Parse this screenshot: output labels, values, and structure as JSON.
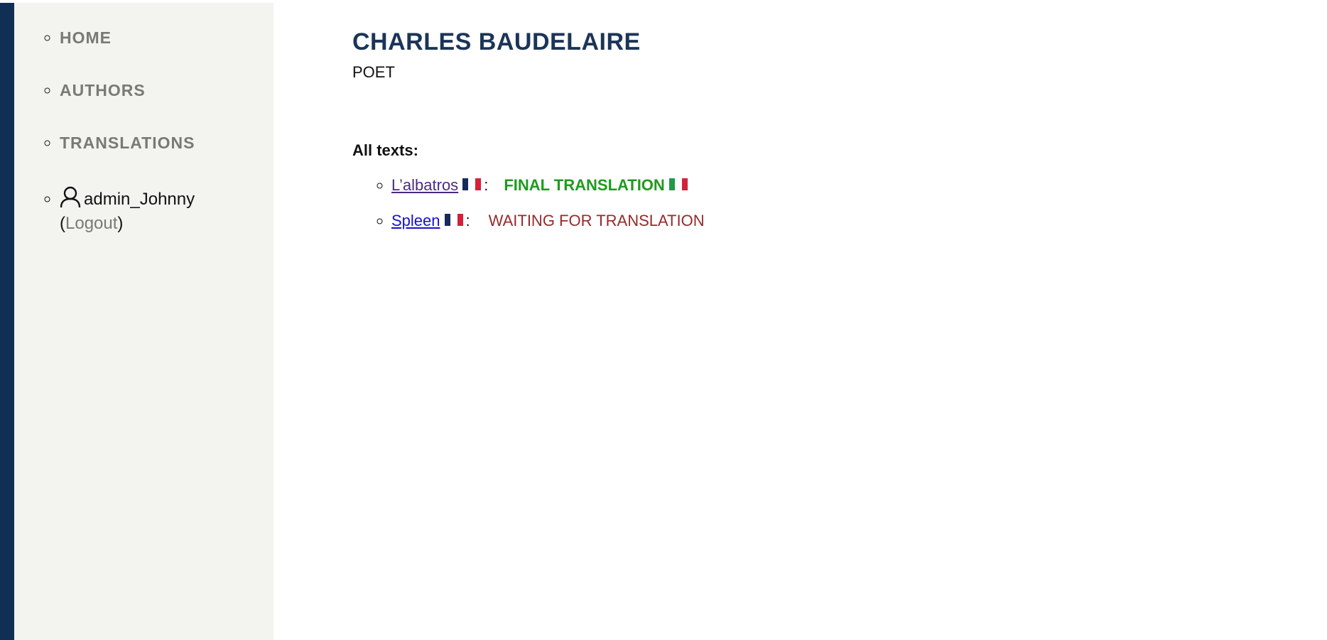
{
  "nav": {
    "items": [
      {
        "label": "HOME"
      },
      {
        "label": "AUTHORS"
      },
      {
        "label": "TRANSLATIONS"
      }
    ],
    "user": {
      "icon": "user-icon",
      "username": "admin_Johnny",
      "open_paren": "(",
      "logout_label": "Logout",
      "close_paren": ")"
    }
  },
  "author": {
    "name": "CHARLES BAUDELAIRE",
    "role": "POET"
  },
  "texts_section": {
    "title": "All texts:",
    "items": [
      {
        "title": "L’albatros",
        "source_flag": "france-flag",
        "separator": ":",
        "status": "FINAL TRANSLATION",
        "target_flag": "italy-flag"
      },
      {
        "title": "Spleen",
        "source_flag": "france-flag",
        "separator": ":",
        "status": "WAITING FOR TRANSLATION"
      }
    ]
  },
  "colors": {
    "accent": "#102f55",
    "sidebar_bg": "#f3f3ef",
    "heading": "#1b3558",
    "status_final": "#1f9a1f",
    "status_waiting": "#962a2a",
    "link_visited": "#4b2a83",
    "link_unvisited": "#1a0fd0"
  }
}
